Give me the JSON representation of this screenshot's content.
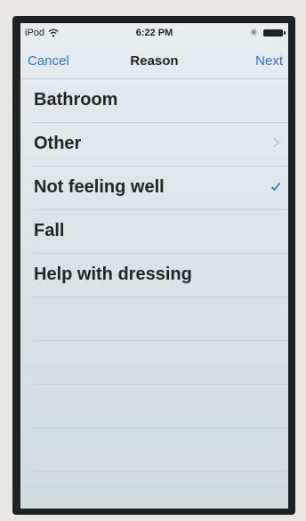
{
  "status_bar": {
    "carrier": "iPod",
    "time": "6:22 PM",
    "icons": [
      "wifi-icon",
      "bluetooth-icon",
      "battery-icon"
    ]
  },
  "nav": {
    "cancel": "Cancel",
    "title": "Reason",
    "next": "Next"
  },
  "reasons": [
    {
      "label": "Bathroom",
      "accessory": ""
    },
    {
      "label": "Other",
      "accessory": "chevron-right-icon"
    },
    {
      "label": "Not feeling well",
      "accessory": "checkmark-icon"
    },
    {
      "label": "Fall",
      "accessory": ""
    },
    {
      "label": "Help with dressing",
      "accessory": ""
    }
  ],
  "selected_reason": "Not feeling well",
  "colors": {
    "accent": "#2f6fd6",
    "text": "#222629",
    "separator": "#c7ced2"
  }
}
